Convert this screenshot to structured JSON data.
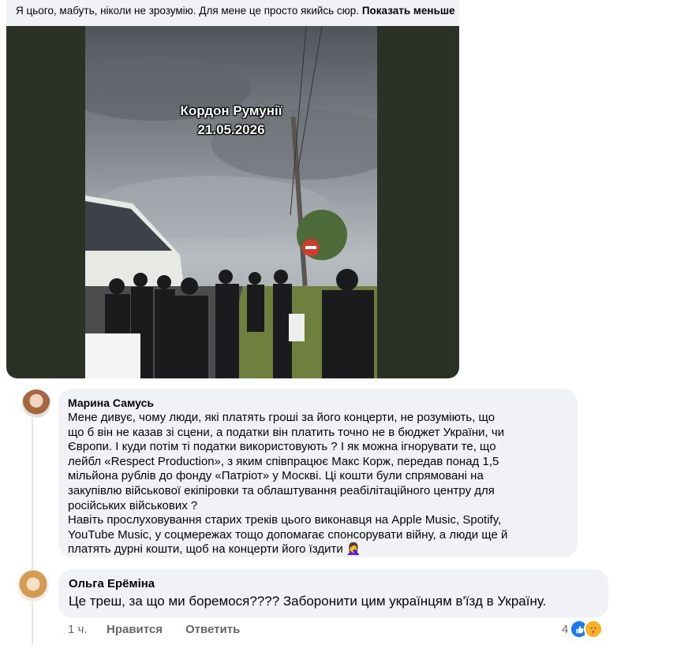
{
  "top_comment": {
    "text": "Я цього, мабуть, ніколи не зрозумію. Для мене це просто якийсь сюр.",
    "see_less_label": "Показать меньше",
    "media_overlay_line1": "Кордон Румунії",
    "media_overlay_line2": "21.05.2026"
  },
  "comments": [
    {
      "author": "Марина Самусь",
      "lines": [
        "Мене дивує, чому люди, які платять гроші за його концерти, не розуміють, що",
        "що б він не казав зі сцени, а податки він платить точно не в бюджет України, чи",
        "Європи. І куди потім ті податки використовують ? І як можна ігнорувати те, що",
        "лейбл «Respect Production», з яким співпрацює Макс Корж, передав понад 1,5",
        "мільйона рублів до фонду «Патріот» у Москві. Ці кошти були спрямовані на",
        "закупівлю військової екіпіровки та облаштування реабілітаційного центру для",
        "російських військових ?",
        "Навіть прослуховування старих треків цього виконавця на Apple Music, Spotify,",
        "YouTube Music, у соцмережах тощо допомагає спонсорувати війну, а люди ще й",
        "платять дурні кошти, щоб на концерти його їздити 🤦‍♀️"
      ]
    },
    {
      "author": "Ольга Ерёміна",
      "text": "Це треш, за що ми боремося???? Заборонити цим українцям в'їзд в Україну.",
      "time": "1 ч.",
      "like_label": "Нравится",
      "reply_label": "Ответить",
      "reaction_count": "4"
    }
  ],
  "colors": {
    "bubble": "#f0f2f5",
    "meta_text": "#65676b",
    "like_blue": "#1877f2",
    "care_yellow": "#f7b125"
  },
  "icons": [
    "like-reaction-icon",
    "care-reaction-icon"
  ]
}
